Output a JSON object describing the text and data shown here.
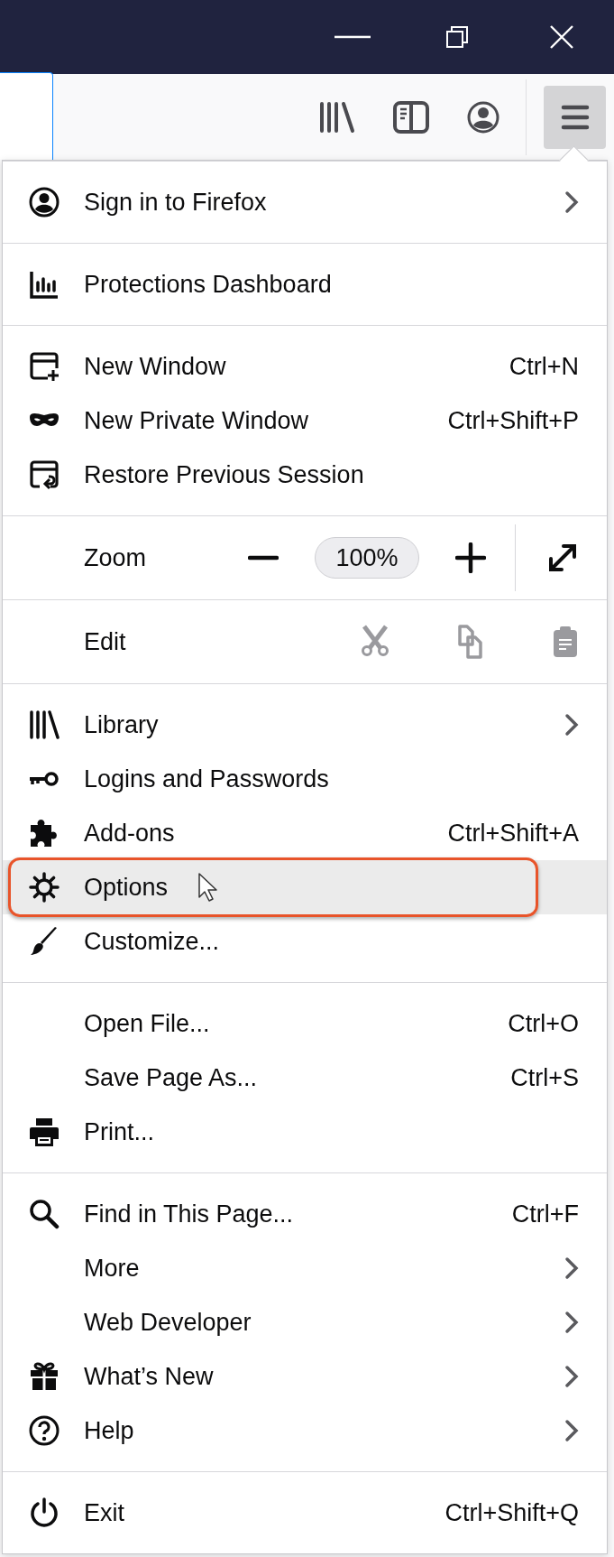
{
  "toolbar": {
    "menu_open": true
  },
  "menu": {
    "sections": [
      {
        "items": [
          {
            "kind": "item",
            "label": "Sign in to Firefox",
            "submenu": true,
            "highlighted": false
          }
        ]
      },
      {
        "items": [
          {
            "kind": "item",
            "label": "Protections Dashboard",
            "submenu": false,
            "highlighted": false
          }
        ]
      },
      {
        "items": [
          {
            "kind": "item",
            "label": "New Window",
            "shortcut": "Ctrl+N",
            "submenu": false,
            "highlighted": false
          },
          {
            "kind": "item",
            "label": "New Private Window",
            "shortcut": "Ctrl+Shift+P",
            "submenu": false,
            "highlighted": false
          },
          {
            "kind": "item",
            "label": "Restore Previous Session",
            "submenu": false,
            "highlighted": false
          }
        ]
      },
      {
        "items": [
          {
            "kind": "zoom",
            "label": "Zoom",
            "value": "100%"
          }
        ]
      },
      {
        "items": [
          {
            "kind": "edit",
            "label": "Edit",
            "disabled": true
          }
        ]
      },
      {
        "items": [
          {
            "kind": "item",
            "label": "Library",
            "submenu": true,
            "highlighted": false
          },
          {
            "kind": "item",
            "label": "Logins and Passwords",
            "submenu": false,
            "highlighted": false
          },
          {
            "kind": "item",
            "label": "Add-ons",
            "shortcut": "Ctrl+Shift+A",
            "submenu": false,
            "highlighted": false
          },
          {
            "kind": "item",
            "label": "Options",
            "submenu": false,
            "highlighted": true
          },
          {
            "kind": "item",
            "label": "Customize...",
            "submenu": false,
            "highlighted": false
          }
        ]
      },
      {
        "items": [
          {
            "kind": "item",
            "label": "Open File...",
            "shortcut": "Ctrl+O",
            "submenu": false,
            "highlighted": false
          },
          {
            "kind": "item",
            "label": "Save Page As...",
            "shortcut": "Ctrl+S",
            "submenu": false,
            "highlighted": false
          },
          {
            "kind": "item",
            "label": "Print...",
            "submenu": false,
            "highlighted": false
          }
        ]
      },
      {
        "items": [
          {
            "kind": "item",
            "label": "Find in This Page...",
            "shortcut": "Ctrl+F",
            "submenu": false,
            "highlighted": false
          },
          {
            "kind": "item",
            "label": "More",
            "submenu": true,
            "highlighted": false
          },
          {
            "kind": "item",
            "label": "Web Developer",
            "submenu": true,
            "highlighted": false
          },
          {
            "kind": "item",
            "label": "What’s New",
            "submenu": true,
            "highlighted": false
          },
          {
            "kind": "item",
            "label": "Help",
            "submenu": true,
            "highlighted": false
          }
        ]
      },
      {
        "items": [
          {
            "kind": "item",
            "label": "Exit",
            "shortcut": "Ctrl+Shift+Q",
            "submenu": false,
            "highlighted": false
          }
        ]
      }
    ]
  }
}
